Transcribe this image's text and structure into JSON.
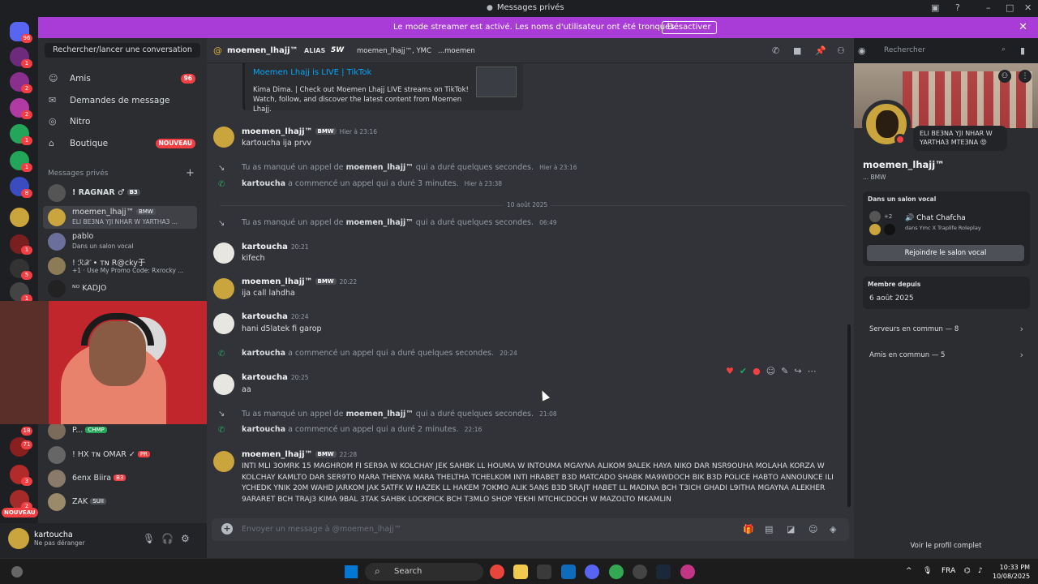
{
  "window": {
    "title": "Messages privés"
  },
  "streamer_bar": {
    "message": "Le mode streamer est activé. Les noms d'utilisateur ont été tronqués.",
    "button": "Désactiver"
  },
  "rail": {
    "badges": [
      "96",
      "1",
      "2",
      "2",
      "1",
      "1",
      "8",
      "1",
      "5",
      "1",
      "18",
      "71",
      "3",
      "2",
      "1"
    ],
    "new_label": "NOUVEAU"
  },
  "sidebar": {
    "search_placeholder": "Rechercher/lancer une conversation",
    "nav": [
      {
        "label": "Amis",
        "badge": "96"
      },
      {
        "label": "Demandes de message",
        "badge": ""
      },
      {
        "label": "Nitro",
        "badge": ""
      },
      {
        "label": "Boutique",
        "badge": "NOUVEAU"
      }
    ],
    "dm_header": "Messages privés",
    "dms": [
      {
        "name": "! RAGNAR ♂",
        "tag": "B3",
        "status": ""
      },
      {
        "name": "moemen_lhajj™",
        "tag": "BMW",
        "status": "ELI BE3NA YJI NHAR W YARTHA3 ..."
      },
      {
        "name": "pablo",
        "tag": "",
        "status": "Dans un salon vocal"
      },
      {
        "name": "! ℛ𝒳 • ᴛɴ R@cky于",
        "tag": "",
        "status": "+1 · Use My Promo Code: Rxrocky ..."
      },
      {
        "name": "ᴺᴼ KADJO",
        "tag": "",
        "status": ""
      },
      {
        "name": "P...",
        "tag": "CHMP",
        "status": ""
      },
      {
        "name": "! HX ᴛɴ OMAR ✓",
        "tag": "PR",
        "status": ""
      },
      {
        "name": "6enx Biira",
        "tag": "B3",
        "status": ""
      },
      {
        "name": "ZAK",
        "tag": "SUII",
        "status": ""
      }
    ]
  },
  "user_panel": {
    "name": "kartoucha",
    "status": "Ne pas déranger"
  },
  "channel": {
    "name": "moemen_lhajj™",
    "alias_label": "ALIAS",
    "alias_tag": "5W",
    "mutual1": "moemen_lhajj™, YMC",
    "mutual2": "...moemen",
    "search_placeholder": "Rechercher"
  },
  "embed": {
    "title": "Moemen Lhajj is LIVE | TikTok",
    "description": "Kima Dima. | Check out Moemen Lhajj LIVE streams on TikTok! Watch, follow, and discover the latest content from Moemen Lhajj."
  },
  "messages": {
    "m1_user": "moemen_lhajj™",
    "m1_tag": "BMW",
    "m1_time": "Hier à 23:16",
    "m1_text": "kartoucha ija prvv",
    "s1_pre": "Tu as manqué un appel de",
    "s1_user": "moemen_lhajj™",
    "s1_post": "qui a duré quelques secondes.",
    "s1_time": "Hier à 23:16",
    "s2_user": "kartoucha",
    "s2_text": "a commencé un appel qui a duré 3 minutes.",
    "s2_time": "Hier à 23:38",
    "date_divider": "10 août 2025",
    "s3_pre": "Tu as manqué un appel de",
    "s3_user": "moemen_lhajj™",
    "s3_post": "qui a duré quelques secondes.",
    "s3_time": "06:49",
    "m2_user": "kartoucha",
    "m2_time": "20:21",
    "m2_text": "kifech",
    "m3_user": "moemen_lhajj™",
    "m3_tag": "BMW",
    "m3_time": "20:22",
    "m3_text": "ija call lahdha",
    "m4_user": "kartoucha",
    "m4_time": "20:24",
    "m4_text": "hani d5latek fi garop",
    "s4_user": "kartoucha",
    "s4_text": "a commencé un appel qui a duré quelques secondes.",
    "s4_time": "20:24",
    "m5_user": "kartoucha",
    "m5_time": "20:25",
    "m5_text": "aa",
    "s5_pre": "Tu as manqué un appel de",
    "s5_user": "moemen_lhajj™",
    "s5_post": "qui a duré quelques secondes.",
    "s5_time": "21:08",
    "s6_user": "kartoucha",
    "s6_text": "a commencé un appel qui a duré 2 minutes.",
    "s6_time": "22:16",
    "m6_user": "moemen_lhajj™",
    "m6_tag": "BMW",
    "m6_time": "22:28",
    "m6_text": "INTI  MLI 3OMRK 15 MAGHROM FI SER9A W KOLCHAY JEK SAHBK LL HOUMA W INTOUMA MGAYNA ALIKOM 9ALEK HAYA NIKO DAR NSR9OUHA MOLAHA KORZA W KOLCHAY KAMLTO DAR SER9TO MARA THENYA MARA THELTHA TCHELKOM INTI HRABET B3D MATCADO SHABK MA9WDOCH BIK B3D POLICE HABTO ANNOUNCE ILI YCHEDK YNIK 20M WAHD JARKOM JAK 5ATFK W HAZEK LL HAKEM 7OKMO ALIK 5ANS B3D 5RAJT HABET LL MADINA BCH T3ICH GHADI L9ITHA MGAYNA ALEKHER 9ARARET BCH TRAJ3 KIMA 9BAL 3TAK SAHBK LOCKPICK BCH T3MLO SHOP YEKHI MTCHICDOCH W MAZOLTO MKAMLIN"
  },
  "composer": {
    "placeholder": "Envoyer un message à @moemen_lhajj™"
  },
  "profile": {
    "bubble": "ELI BE3NA YJI NHAR W YARTHA3 MTE3NA 😡",
    "name": "moemen_lhajj™",
    "sub": "...  BMW",
    "voice_header": "Dans un salon vocal",
    "voice_count": "+2",
    "voice_channel": "Chat Chafcha",
    "voice_server": "dans Ymc X Traplife Roleplay",
    "join_button": "Rejoindre le salon vocal",
    "member_header": "Membre depuis",
    "member_date": "6 août 2025",
    "servers_common": "Serveurs en commun — 8",
    "friends_common": "Amis en commun — 5",
    "full_profile": "Voir le profil complet"
  },
  "taskbar": {
    "search": "Search",
    "lang": "FRA",
    "time": "10:33 PM",
    "date": "10/08/2025"
  },
  "colors": {
    "accent": "#a93bd7",
    "link": "#00a8fc",
    "danger": "#f23f43",
    "background": "#313338"
  }
}
